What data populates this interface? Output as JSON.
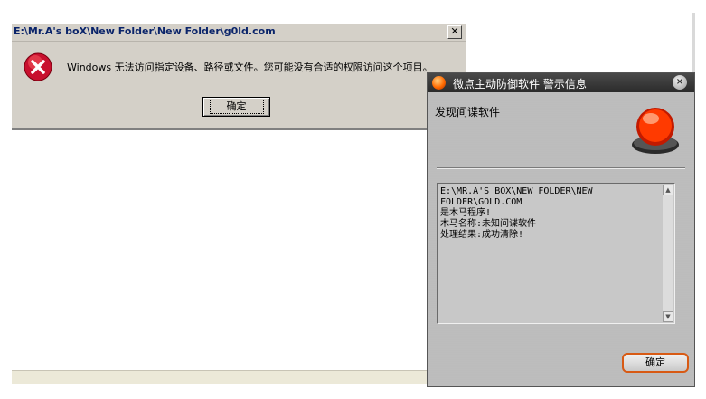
{
  "error_dialog": {
    "title": "E:\\Mr.A's boX\\New Folder\\New Folder\\g0ld.com",
    "close_glyph": "✕",
    "icon": "error-x-icon",
    "message": "Windows 无法访问指定设备、路径或文件。您可能没有合适的权限访问这个项目。",
    "ok_label": "确定"
  },
  "alert_window": {
    "title": "微点主动防御软件   警示信息",
    "close_glyph": "×",
    "heading": "发现间谍软件",
    "icon": "alarm-light-icon",
    "details": "E:\\MR.A'S BOX\\NEW FOLDER\\NEW\nFOLDER\\GOLD.COM\n是木马程序!\n木马名称:未知间谍软件\n处理结果:成功清除!",
    "ok_label": "确定",
    "colors": {
      "titlebar": "#2b2b2b",
      "ok_border": "#d85a14",
      "alarm": "#ff3a00"
    }
  }
}
